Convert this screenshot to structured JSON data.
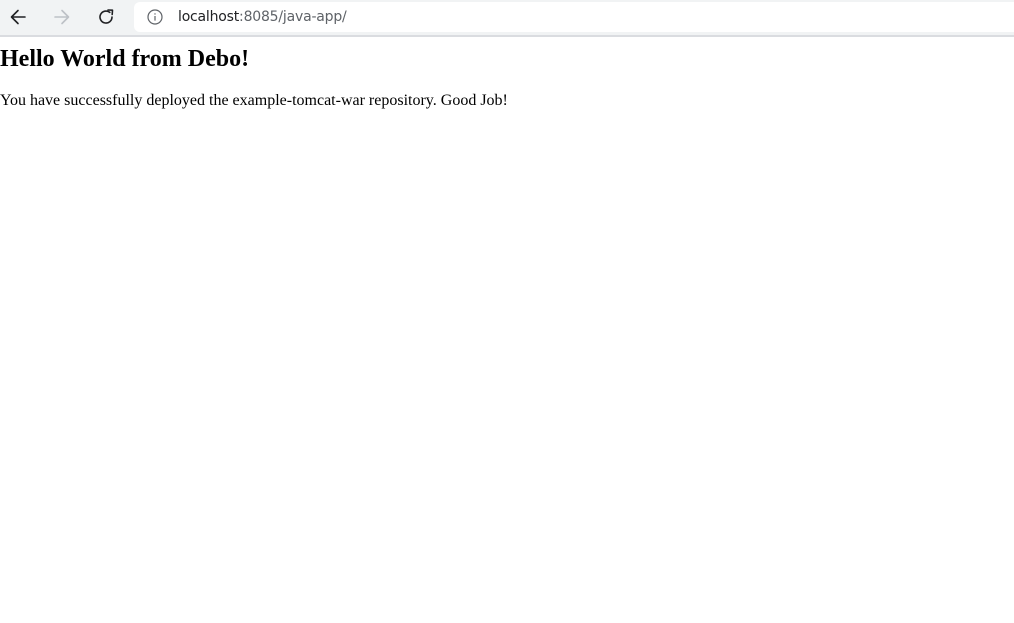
{
  "browser": {
    "address_bar": {
      "host": "localhost",
      "path": ":8085/java-app/"
    },
    "icons": {
      "back": "arrow-left-icon",
      "forward": "arrow-right-icon",
      "reload": "reload-icon",
      "site_info": "info-icon"
    },
    "colors": {
      "toolbar": "#f1f3f4",
      "icon_active": "#202124",
      "icon_disabled": "#bdc1c6"
    }
  },
  "page": {
    "heading": "Hello World from Debo!",
    "message": "You have successfully deployed the example-tomcat-war repository. Good Job!"
  }
}
